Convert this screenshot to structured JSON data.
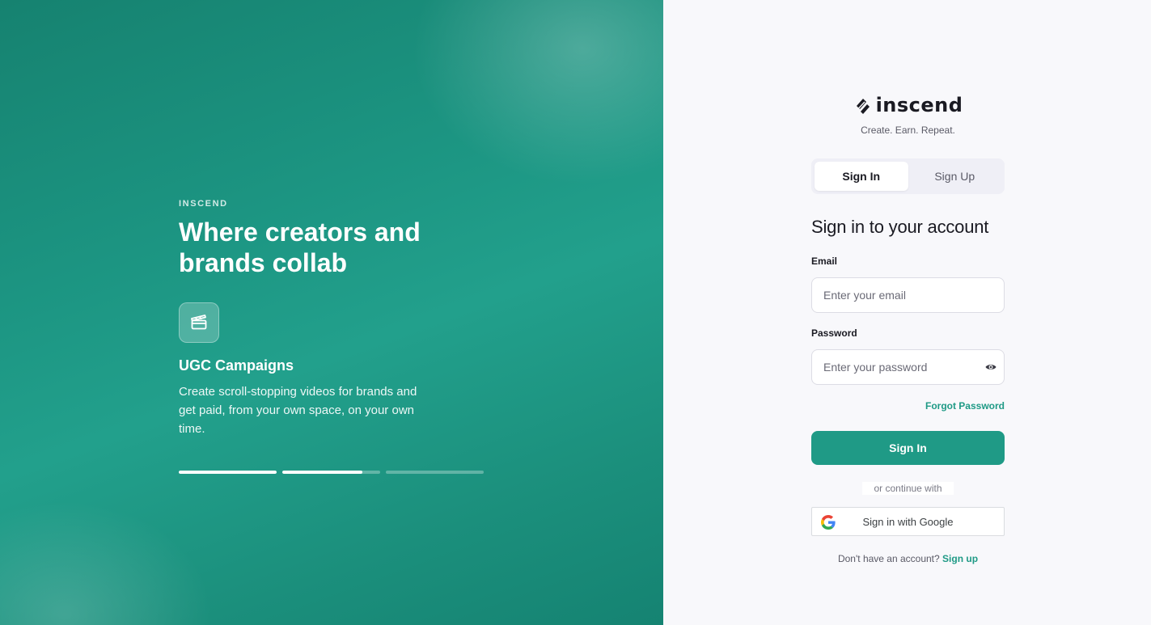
{
  "hero": {
    "eyebrow": "INSCEND",
    "headline": "Where creators and brands collab",
    "feature": {
      "icon": "clapperboard-icon",
      "title": "UGC Campaigns",
      "description": "Create scroll-stopping videos for brands and get paid, from your own space, on your own time."
    },
    "carousel_progress": [
      1.0,
      0.82,
      0.0
    ]
  },
  "brand": {
    "logo_text": "inscend",
    "tagline": "Create. Earn. Repeat."
  },
  "tabs": [
    {
      "label": "Sign In",
      "active": true
    },
    {
      "label": "Sign Up",
      "active": false
    }
  ],
  "form": {
    "title": "Sign in to your account",
    "email_label": "Email",
    "email_placeholder": "Enter your email",
    "password_label": "Password",
    "password_placeholder": "Enter your password",
    "forgot_label": "Forgot Password",
    "submit_label": "Sign In",
    "divider_text": "or continue with",
    "google_label": "Sign in with Google",
    "footer_text": "Don't have an account?",
    "footer_link": "Sign up"
  },
  "colors": {
    "accent": "#1f9a86",
    "hero_bg": "#1c9582"
  }
}
